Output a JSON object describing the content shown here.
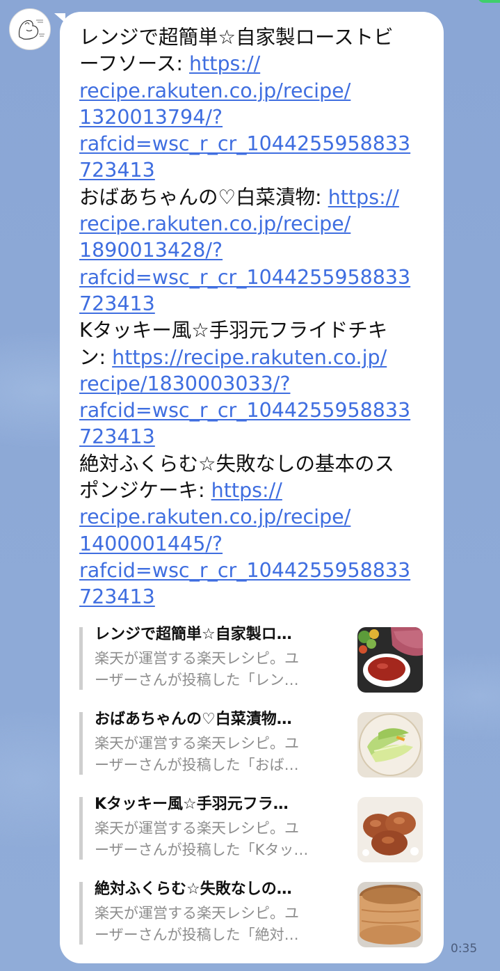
{
  "chat": {
    "time": "0:35",
    "message_lines": [
      {
        "text": "レンジで超簡単☆自家製ローストビ",
        "link": ""
      },
      {
        "text": "ーフソース: ",
        "link": "https://"
      },
      {
        "text": "",
        "link": "recipe.rakuten.co.jp/recipe/"
      },
      {
        "text": "",
        "link": "1320013794/?"
      },
      {
        "text": "",
        "link": "rafcid=wsc_r_cr_1044255958833"
      },
      {
        "text": "",
        "link": "723413"
      },
      {
        "text": "おばあちゃんの♡白菜漬物: ",
        "link": "https://"
      },
      {
        "text": "",
        "link": "recipe.rakuten.co.jp/recipe/"
      },
      {
        "text": "",
        "link": "1890013428/?"
      },
      {
        "text": "",
        "link": "rafcid=wsc_r_cr_1044255958833"
      },
      {
        "text": "",
        "link": "723413"
      },
      {
        "text": "Kタッキー風☆手羽元フライドチキ",
        "link": ""
      },
      {
        "text": "ン: ",
        "link": "https://recipe.rakuten.co.jp/"
      },
      {
        "text": "",
        "link": "recipe/1830003033/?"
      },
      {
        "text": "",
        "link": "rafcid=wsc_r_cr_1044255958833"
      },
      {
        "text": "",
        "link": "723413"
      },
      {
        "text": "絶対ふくらむ☆失敗なしの基本のス",
        "link": ""
      },
      {
        "text": "ポンジケーキ: ",
        "link": "https://"
      },
      {
        "text": "",
        "link": "recipe.rakuten.co.jp/recipe/"
      },
      {
        "text": "",
        "link": "1400001445/?"
      },
      {
        "text": "",
        "link": "rafcid=wsc_r_cr_1044255958833"
      },
      {
        "text": "",
        "link": "723413"
      }
    ],
    "previews": [
      {
        "title": "レンジで超簡単☆自家製ロ…",
        "desc1": "楽天が運営する楽天レシピ。ユ",
        "desc2": "ーザーさんが投稿した「レン…",
        "thumb": "roast-beef"
      },
      {
        "title": "おばあちゃんの♡白菜漬物…",
        "desc1": "楽天が運営する楽天レシピ。ユ",
        "desc2": "ーザーさんが投稿した「おば…",
        "thumb": "pickled-cabbage"
      },
      {
        "title": "Kタッキー風☆手羽元フラ…",
        "desc1": "楽天が運営する楽天レシピ。ユ",
        "desc2": "ーザーさんが投稿した「Kタッ…",
        "thumb": "fried-chicken"
      },
      {
        "title": "絶対ふくらむ☆失敗なしの…",
        "desc1": "楽天が運営する楽天レシピ。ユ",
        "desc2": "ーザーさんが投稿した「絶対…",
        "thumb": "sponge-cake"
      }
    ]
  },
  "colors": {
    "background": "#8ca8d6",
    "bubble": "#ffffff",
    "link": "#3f6ee0",
    "preview_desc": "#8d8d8d"
  }
}
